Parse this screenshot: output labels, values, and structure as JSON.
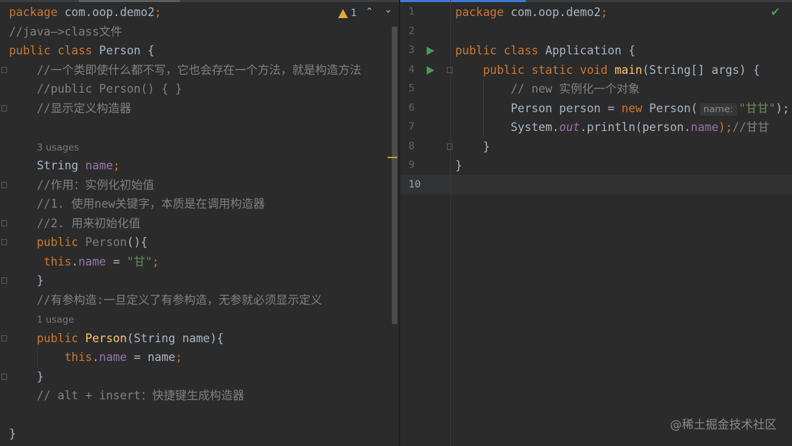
{
  "colors": {
    "background": "#2b2b2b",
    "keyword": "#cc7832",
    "text": "#a9b7c6",
    "comment": "#808080",
    "string": "#6a8759",
    "field": "#9876aa",
    "method": "#ffc66d",
    "run_icon": "#499c54",
    "warning": "#e0a93a"
  },
  "left_editor": {
    "inspection": {
      "icon": "warning-triangle-icon",
      "count": "1",
      "prev_icon": "chevron-up-icon",
      "next_icon": "chevron-down-icon"
    },
    "lines": [
      [
        [
          "package ",
          "kw"
        ],
        [
          "com.oop.demo2",
          ""
        ],
        [
          ";",
          "kw"
        ]
      ],
      [
        [
          "//java—>class文件",
          "cm"
        ]
      ],
      [
        [
          "public class ",
          "kw"
        ],
        [
          "Person {",
          ""
        ]
      ],
      [
        [
          "    //一个类即使什么都不写，它也会存在一个方法，就是构造方法",
          "cm"
        ]
      ],
      [
        [
          "    //public Person() { }",
          "cm"
        ]
      ],
      [
        [
          "    //显示定义构造器",
          "cm"
        ]
      ],
      [],
      [
        [
          "    ",
          ""
        ],
        [
          "3 usages",
          "hint"
        ]
      ],
      [
        [
          "    String ",
          ""
        ],
        [
          "name",
          "fld"
        ],
        [
          ";",
          "kw"
        ]
      ],
      [
        [
          "    //作用：实例化初始值",
          "cm"
        ]
      ],
      [
        [
          "    //1. 使用new关键字，本质是在调用构造器",
          "cm"
        ]
      ],
      [
        [
          "    //2. 用来初始化值",
          "cm"
        ]
      ],
      [
        [
          "    public ",
          "kw"
        ],
        [
          "Person",
          "grey"
        ],
        [
          "(){",
          ""
        ]
      ],
      [
        [
          "     this",
          "kw"
        ],
        [
          ".",
          ""
        ],
        [
          "name",
          "fld"
        ],
        [
          " = ",
          ""
        ],
        [
          "\"甘\"",
          "str"
        ],
        [
          ";",
          "kw"
        ]
      ],
      [
        [
          "    }",
          ""
        ]
      ],
      [
        [
          "    //有参构造:一旦定义了有参构造，无参就必须显示定义",
          "cm"
        ]
      ],
      [
        [
          "    ",
          ""
        ],
        [
          "1 usage",
          "hint"
        ]
      ],
      [
        [
          "    public ",
          "kw"
        ],
        [
          "Person",
          "mth"
        ],
        [
          "(String name){",
          ""
        ]
      ],
      [
        [
          "        this",
          "kw"
        ],
        [
          ".",
          ""
        ],
        [
          "name",
          "fld"
        ],
        [
          " = name",
          ""
        ],
        [
          ";",
          "kw"
        ]
      ],
      [
        [
          "    }",
          ""
        ]
      ],
      [
        [
          "    // alt + insert：快捷键生成构造器",
          "cm"
        ]
      ],
      [],
      [
        [
          "}",
          ""
        ]
      ]
    ]
  },
  "right_editor": {
    "status_icon": "check-icon",
    "line_numbers": [
      "1",
      "2",
      "3",
      "4",
      "5",
      "6",
      "7",
      "8",
      "9",
      "10"
    ],
    "run_lines": [
      3,
      4
    ],
    "current_line": 10,
    "lines": [
      [
        [
          "package ",
          "kw"
        ],
        [
          "com.oop.demo2",
          ""
        ],
        [
          ";",
          "kw"
        ]
      ],
      [],
      [
        [
          "public class ",
          "kw"
        ],
        [
          "Application {",
          ""
        ]
      ],
      [
        [
          "    public static void ",
          "kw"
        ],
        [
          "main",
          "mth"
        ],
        [
          "(String[] args) {",
          ""
        ]
      ],
      [
        [
          "        // new 实例化一个对象",
          "cm"
        ]
      ],
      [
        [
          "        Person person = ",
          ""
        ],
        [
          "new ",
          "kw"
        ],
        [
          "Person(",
          ""
        ],
        [
          "name:",
          "param"
        ],
        [
          "\"甘甘\"",
          "str"
        ],
        [
          ");",
          ""
        ]
      ],
      [
        [
          "        System.",
          ""
        ],
        [
          "out",
          "ital"
        ],
        [
          ".println(person.",
          ""
        ],
        [
          "name",
          "fld"
        ],
        [
          ");",
          "kw"
        ],
        [
          "//甘甘",
          "cm"
        ]
      ],
      [
        [
          "    }",
          ""
        ]
      ],
      [
        [
          "}",
          ""
        ]
      ],
      []
    ]
  },
  "watermark": "@稀土掘金技术社区"
}
